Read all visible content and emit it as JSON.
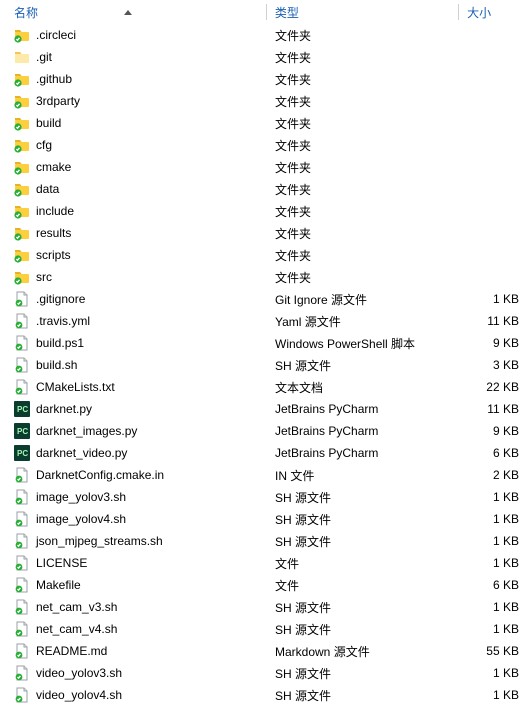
{
  "columns": {
    "name": "名称",
    "type": "类型",
    "size": "大小"
  },
  "type_labels": {
    "folder": "文件夹",
    "gitignore": "Git Ignore 源文件",
    "yaml": "Yaml 源文件",
    "powershell": "Windows PowerShell 脚本",
    "sh": "SH 源文件",
    "text": "文本文档",
    "pycharm": "JetBrains PyCharm",
    "in": "IN 文件",
    "file": "文件",
    "markdown": "Markdown 源文件"
  },
  "items": [
    {
      "name": ".circleci",
      "typeKey": "folder",
      "icon": "folder",
      "size": ""
    },
    {
      "name": ".git",
      "typeKey": "folder",
      "icon": "folder-plain",
      "size": ""
    },
    {
      "name": ".github",
      "typeKey": "folder",
      "icon": "folder",
      "size": ""
    },
    {
      "name": "3rdparty",
      "typeKey": "folder",
      "icon": "folder",
      "size": ""
    },
    {
      "name": "build",
      "typeKey": "folder",
      "icon": "folder",
      "size": ""
    },
    {
      "name": "cfg",
      "typeKey": "folder",
      "icon": "folder",
      "size": ""
    },
    {
      "name": "cmake",
      "typeKey": "folder",
      "icon": "folder",
      "size": ""
    },
    {
      "name": "data",
      "typeKey": "folder",
      "icon": "folder",
      "size": ""
    },
    {
      "name": "include",
      "typeKey": "folder",
      "icon": "folder",
      "size": ""
    },
    {
      "name": "results",
      "typeKey": "folder",
      "icon": "folder",
      "size": ""
    },
    {
      "name": "scripts",
      "typeKey": "folder",
      "icon": "folder",
      "size": ""
    },
    {
      "name": "src",
      "typeKey": "folder",
      "icon": "folder",
      "size": ""
    },
    {
      "name": ".gitignore",
      "typeKey": "gitignore",
      "icon": "file",
      "size": "1 KB"
    },
    {
      "name": ".travis.yml",
      "typeKey": "yaml",
      "icon": "file",
      "size": "11 KB"
    },
    {
      "name": "build.ps1",
      "typeKey": "powershell",
      "icon": "file",
      "size": "9 KB"
    },
    {
      "name": "build.sh",
      "typeKey": "sh",
      "icon": "file",
      "size": "3 KB"
    },
    {
      "name": "CMakeLists.txt",
      "typeKey": "text",
      "icon": "file",
      "size": "22 KB"
    },
    {
      "name": "darknet.py",
      "typeKey": "pycharm",
      "icon": "pycharm",
      "size": "11 KB"
    },
    {
      "name": "darknet_images.py",
      "typeKey": "pycharm",
      "icon": "pycharm",
      "size": "9 KB"
    },
    {
      "name": "darknet_video.py",
      "typeKey": "pycharm",
      "icon": "pycharm",
      "size": "6 KB"
    },
    {
      "name": "DarknetConfig.cmake.in",
      "typeKey": "in",
      "icon": "file",
      "size": "2 KB"
    },
    {
      "name": "image_yolov3.sh",
      "typeKey": "sh",
      "icon": "file",
      "size": "1 KB"
    },
    {
      "name": "image_yolov4.sh",
      "typeKey": "sh",
      "icon": "file",
      "size": "1 KB"
    },
    {
      "name": "json_mjpeg_streams.sh",
      "typeKey": "sh",
      "icon": "file",
      "size": "1 KB"
    },
    {
      "name": "LICENSE",
      "typeKey": "file",
      "icon": "file",
      "size": "1 KB"
    },
    {
      "name": "Makefile",
      "typeKey": "file",
      "icon": "file",
      "size": "6 KB"
    },
    {
      "name": "net_cam_v3.sh",
      "typeKey": "sh",
      "icon": "file",
      "size": "1 KB"
    },
    {
      "name": "net_cam_v4.sh",
      "typeKey": "sh",
      "icon": "file",
      "size": "1 KB"
    },
    {
      "name": "README.md",
      "typeKey": "markdown",
      "icon": "file",
      "size": "55 KB"
    },
    {
      "name": "video_yolov3.sh",
      "typeKey": "sh",
      "icon": "file",
      "size": "1 KB"
    },
    {
      "name": "video_yolov4.sh",
      "typeKey": "sh",
      "icon": "file",
      "size": "1 KB"
    }
  ]
}
